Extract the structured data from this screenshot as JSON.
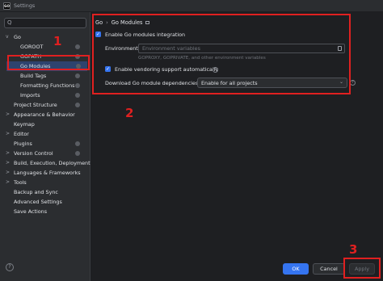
{
  "window": {
    "title": "Settings"
  },
  "search": {
    "placeholder": "Q"
  },
  "tree": [
    {
      "label": "Go",
      "expand": "v"
    },
    {
      "label": "GOROOT"
    },
    {
      "label": "GOPATH"
    },
    {
      "label": "Go Modules"
    },
    {
      "label": "Build Tags"
    },
    {
      "label": "Formatting Functions"
    },
    {
      "label": "Imports"
    },
    {
      "label": "Project Structure"
    },
    {
      "label": "Appearance & Behavior",
      "expand": ">"
    },
    {
      "label": "Keymap"
    },
    {
      "label": "Editor",
      "expand": ">"
    },
    {
      "label": "Plugins"
    },
    {
      "label": "Version Control",
      "expand": ">"
    },
    {
      "label": "Build, Execution, Deployment",
      "expand": ">"
    },
    {
      "label": "Languages & Frameworks",
      "expand": ">"
    },
    {
      "label": "Tools",
      "expand": ">"
    },
    {
      "label": "Backup and Sync"
    },
    {
      "label": "Advanced Settings"
    },
    {
      "label": "Save Actions"
    }
  ],
  "breadcrumb": {
    "root": "Go",
    "separator": "›",
    "current": "Go Modules"
  },
  "settings": {
    "enable_integration": "Enable Go modules integration",
    "environment_label": "Environment:",
    "environment_placeholder": "Environment variables",
    "environment_hint": "GOPROXY, GOPRIVATE, and other environment variables",
    "vendoring": "Enable vendoring support automatically",
    "download_label": "Download Go module dependencies:",
    "download_value": "Enable for all projects",
    "check": "✓",
    "help": "?"
  },
  "markers": {
    "one": "1",
    "two": "2",
    "three": "3"
  },
  "footer": {
    "help": "?",
    "ok": "OK",
    "cancel": "Cancel",
    "apply": "Apply"
  },
  "colors": {
    "accent": "#3574f0",
    "highlight": "#e02020",
    "selected": "#2e436e",
    "background": "#1e1f22",
    "panel": "#2b2d30"
  }
}
